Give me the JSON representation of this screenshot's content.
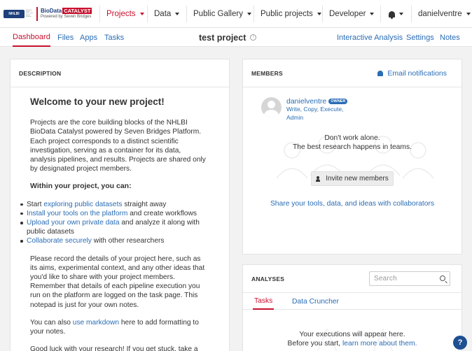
{
  "brand": {
    "nhlbi": "NHLBI",
    "nhlbi_sub": "National Heart, Lung, and Blood Institute",
    "name": "BioData",
    "tag": "CATALYST",
    "sub": "Powered by Seven Bridges"
  },
  "topnav": {
    "projects": "Projects",
    "data": "Data",
    "public_gallery": "Public Gallery",
    "public_projects": "Public projects",
    "developer": "Developer",
    "user": "danielventre"
  },
  "subnav": {
    "dashboard": "Dashboard",
    "files": "Files",
    "apps": "Apps",
    "tasks": "Tasks",
    "project_title": "test project",
    "info_glyph": "i",
    "interactive": "Interactive Analysis",
    "settings": "Settings",
    "notes": "Notes"
  },
  "description": {
    "header": "DESCRIPTION",
    "welcome": "Welcome to your new project!",
    "intro": "Projects are the core building blocks of the NHLBI BioData Catalyst powered by Seven Bridges Platform. Each project corresponds to a distinct scientific investigation, serving as a container for its data, analysis pipelines, and results. Projects are shared only by designated project members.",
    "within": "Within your project, you can:",
    "b1_pre": "Start ",
    "b1_link": "exploring public datasets",
    "b1_post": " straight away",
    "b2_link": "Install your tools on the platform",
    "b2_post": " and create workflows",
    "b3_link": "Upload your own private data",
    "b3_post": " and analyze it along with public datasets",
    "b4_link": "Collaborate securely",
    "b4_post": " with other researchers",
    "record": "Please record the details of your project here, such as its aims, experimental context, and any other ideas that you'd like to share with your project members. Remember that details of each pipeline execution you run on the platform are logged on the task page. This notepad is just for your own notes.",
    "md_pre": "You can also ",
    "md_link": "use markdown",
    "md_post": " here to add formatting to your notes.",
    "cutoff": "Good luck with your research! If you get stuck, take a look"
  },
  "members": {
    "header": "MEMBERS",
    "email": "Email notifications",
    "member_name": "danielventre",
    "member_role": "OWNER",
    "member_perm": "Write, Copy, Execute, Admin",
    "msg1": "Don't work alone.",
    "msg2": "The best research happens in teams.",
    "invite": "Invite new members",
    "share": "Share your tools, data, and ideas with collaborators"
  },
  "analyses": {
    "header": "ANALYSES",
    "search_placeholder": "Search",
    "tab_tasks": "Tasks",
    "tab_cruncher": "Data Cruncher",
    "exec1": "Your executions will appear here.",
    "exec2_pre": "Before you start, ",
    "exec2_link": "learn more about them."
  },
  "help": "?"
}
